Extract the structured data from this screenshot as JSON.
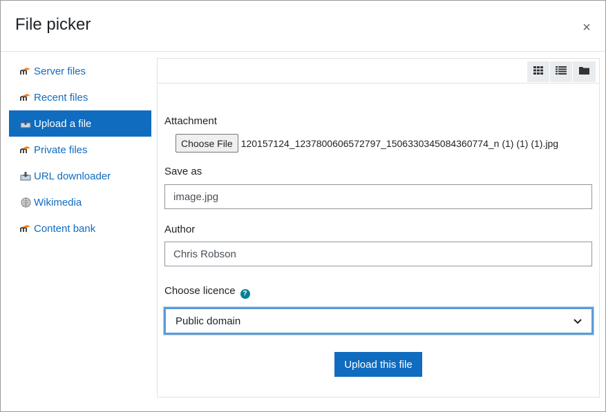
{
  "dialog": {
    "title": "File picker",
    "close_label": "×"
  },
  "sidebar": {
    "items": [
      {
        "label": "Server files",
        "icon": "moodle-icon",
        "active": false
      },
      {
        "label": "Recent files",
        "icon": "moodle-icon",
        "active": false
      },
      {
        "label": "Upload a file",
        "icon": "upload-icon",
        "active": true
      },
      {
        "label": "Private files",
        "icon": "moodle-icon",
        "active": false
      },
      {
        "label": "URL downloader",
        "icon": "url-downloader-icon",
        "active": false
      },
      {
        "label": "Wikimedia",
        "icon": "wikimedia-icon",
        "active": false
      },
      {
        "label": "Content bank",
        "icon": "moodle-icon",
        "active": false
      }
    ]
  },
  "toolbar": {
    "views": [
      "grid-view-icon",
      "list-view-icon",
      "folder-view-icon"
    ]
  },
  "form": {
    "attachment_label": "Attachment",
    "choose_file_label": "Choose File",
    "file_name": "120157124_1237800606572797_1506330345084360774_n (1) (1) (1).jpg",
    "save_as_label": "Save as",
    "save_as_value": "image.jpg",
    "author_label": "Author",
    "author_value": "Chris Robson",
    "licence_label": "Choose licence",
    "licence_value": "Public domain",
    "upload_label": "Upload this file"
  },
  "colors": {
    "accent": "#0f6cbf",
    "help": "#008196",
    "moodle_orange": "#f98012"
  }
}
